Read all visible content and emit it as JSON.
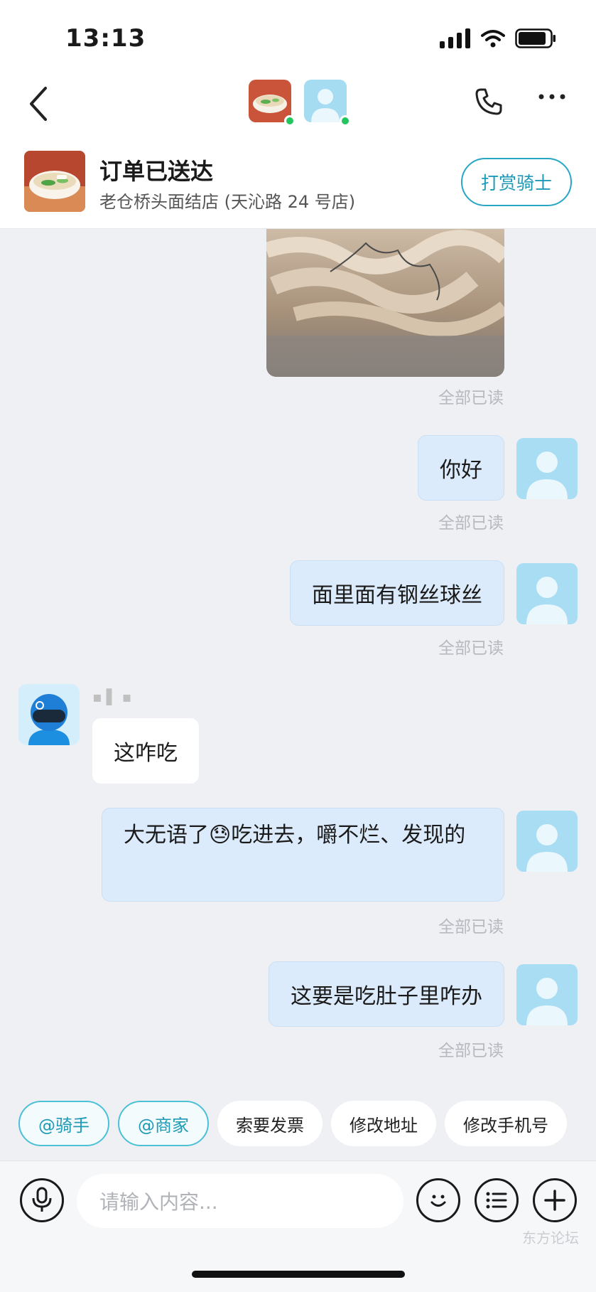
{
  "status_bar": {
    "time": "13:13"
  },
  "header": {
    "back_icon": "chevron-left-icon",
    "phone_icon": "phone-icon",
    "more_icon": "more-horizontal-icon"
  },
  "order": {
    "title": "订单已送达",
    "store": "老仓桥头面结店 (天沁路 24 号店)",
    "tip_button": "打赏骑士"
  },
  "messages": {
    "read_label": "全部已读",
    "m1": "你好",
    "m2": "面里面有钢丝球丝",
    "rider_reply": "这咋吃",
    "m3_part1": "大无语了",
    "m3_emoji": "😓",
    "m3_part2": "吃进去，嚼不烂、发现的",
    "m4": "这要是吃肚子里咋办"
  },
  "quick_actions": [
    "@骑手",
    "@商家",
    "索要发票",
    "修改地址",
    "修改手机号"
  ],
  "input": {
    "placeholder": "请输入内容..."
  },
  "watermark": "东方论坛",
  "colors": {
    "accent": "#1f9ab6",
    "outgoing_bubble": "#dcebfb",
    "online": "#22c55e"
  }
}
